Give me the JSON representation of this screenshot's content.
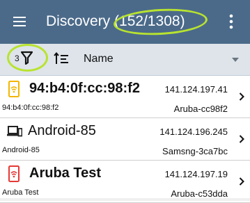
{
  "app_bar": {
    "title": "Discovery (152/1308)",
    "background_color": "#4b6a8a",
    "menu_icon": "hamburger-menu-icon",
    "overflow_icon": "more-vert-icon"
  },
  "toolbar": {
    "filter_count": "3",
    "filter_icon": "filter-funnel-icon",
    "sort_icon": "sort-order-icon",
    "sort_label": "Name",
    "dropdown_icon": "caret-down-icon"
  },
  "annotation_color": "#b8e32f",
  "devices": [
    {
      "name": "94:b4:0f:cc:98:f2",
      "ip": "141.124.197.41",
      "subtitle": "94:b4:0f:cc:98:f2",
      "hostname": "Aruba-cc98f2",
      "icon": "access-point-yellow-icon",
      "icon_color": "#f2b600"
    },
    {
      "name": "Android-85",
      "ip": "141.124.196.245",
      "subtitle": "Android-85",
      "hostname": "Samsng-3ca7bc",
      "icon": "laptop-phone-icon",
      "icon_color": "#222222"
    },
    {
      "name": "Aruba Test",
      "ip": "141.124.197.19",
      "subtitle": "Aruba Test",
      "hostname": "Aruba-c53dda",
      "icon": "access-point-red-icon",
      "icon_color": "#e53935"
    }
  ]
}
